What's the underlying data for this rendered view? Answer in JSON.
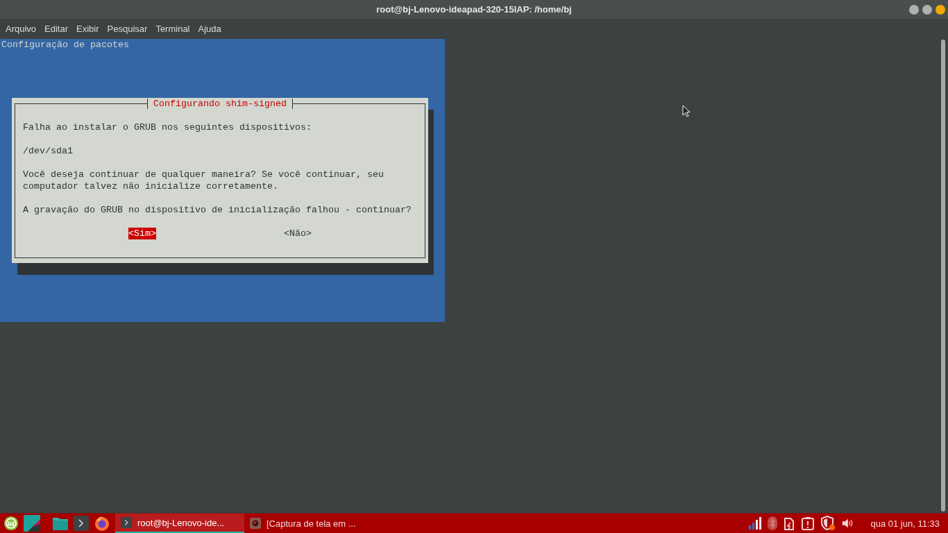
{
  "window": {
    "title": "root@bj-Lenovo-ideapad-320-15IAP: /home/bj"
  },
  "menu": [
    "Arquivo",
    "Editar",
    "Exibir",
    "Pesquisar",
    "Terminal",
    "Ajuda"
  ],
  "terminal": {
    "header": "Configuração de pacotes",
    "dialog": {
      "title": "Configurando shim-signed",
      "paragraphs": [
        "Falha ao instalar o GRUB nos seguintes dispositivos:",
        "/dev/sda1",
        "Você deseja continuar de qualquer maneira? Se você continuar, seu computador talvez não inicialize corretamente.",
        "A gravação do GRUB no dispositivo de inicialização falhou - continuar?"
      ],
      "buttons": [
        {
          "label": "<Sim>",
          "selected": true
        },
        {
          "label": "<Não>",
          "selected": false
        }
      ]
    }
  },
  "taskbar": {
    "tasks": [
      {
        "label": "root@bj-Lenovo-ide...",
        "kind": "terminal",
        "active": true
      },
      {
        "label": "[Captura de tela em ...",
        "kind": "screenshot",
        "active": false
      }
    ],
    "clock": "qua 01 jun, 11:33"
  }
}
